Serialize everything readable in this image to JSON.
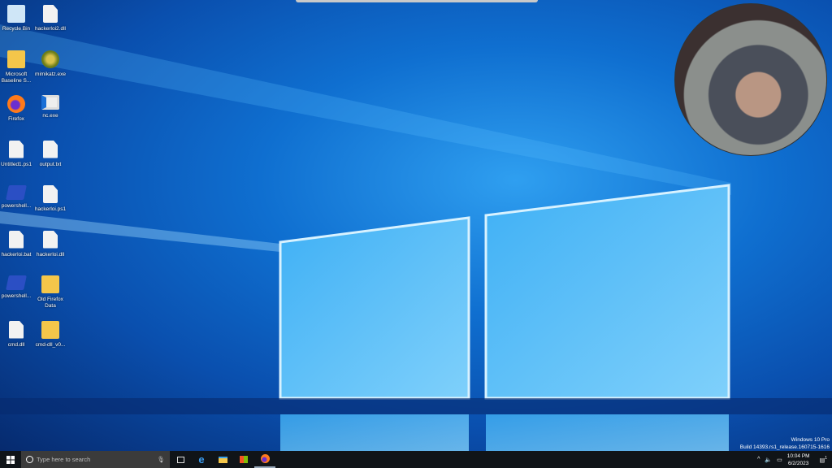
{
  "desktop": {
    "icons": [
      {
        "label": "Recycle Bin",
        "type": "bin"
      },
      {
        "label": "hackerloi2.dll",
        "type": "doc"
      },
      {
        "label": "Microsoft Baseline S...",
        "type": "shield"
      },
      {
        "label": "mimikatz.exe",
        "type": "kiwi"
      },
      {
        "label": "Firefox",
        "type": "firefox"
      },
      {
        "label": "nc.exe",
        "type": "window"
      },
      {
        "label": "Untitled1.ps1",
        "type": "doc"
      },
      {
        "label": "output.txt",
        "type": "doc"
      },
      {
        "label": "powershell...",
        "type": "ps"
      },
      {
        "label": "hackerloi.ps1",
        "type": "doc"
      },
      {
        "label": "hackerloi.bat",
        "type": "bat"
      },
      {
        "label": "hackerloi.dll",
        "type": "doc"
      },
      {
        "label": "powershell...",
        "type": "ps"
      },
      {
        "label": "Old Firefox Data",
        "type": "folder"
      },
      {
        "label": "cmd.dll",
        "type": "doc"
      },
      {
        "label": "cmd-dll_v0...",
        "type": "zip"
      }
    ]
  },
  "watermark": {
    "line1": "Windows 10 Pro",
    "line2": "Build 14393.rs1_release.160715-1616"
  },
  "taskbar": {
    "search_placeholder": "Type here to search",
    "time": "10:04 PM",
    "date": "6/2/2023",
    "notification_count": "1"
  }
}
